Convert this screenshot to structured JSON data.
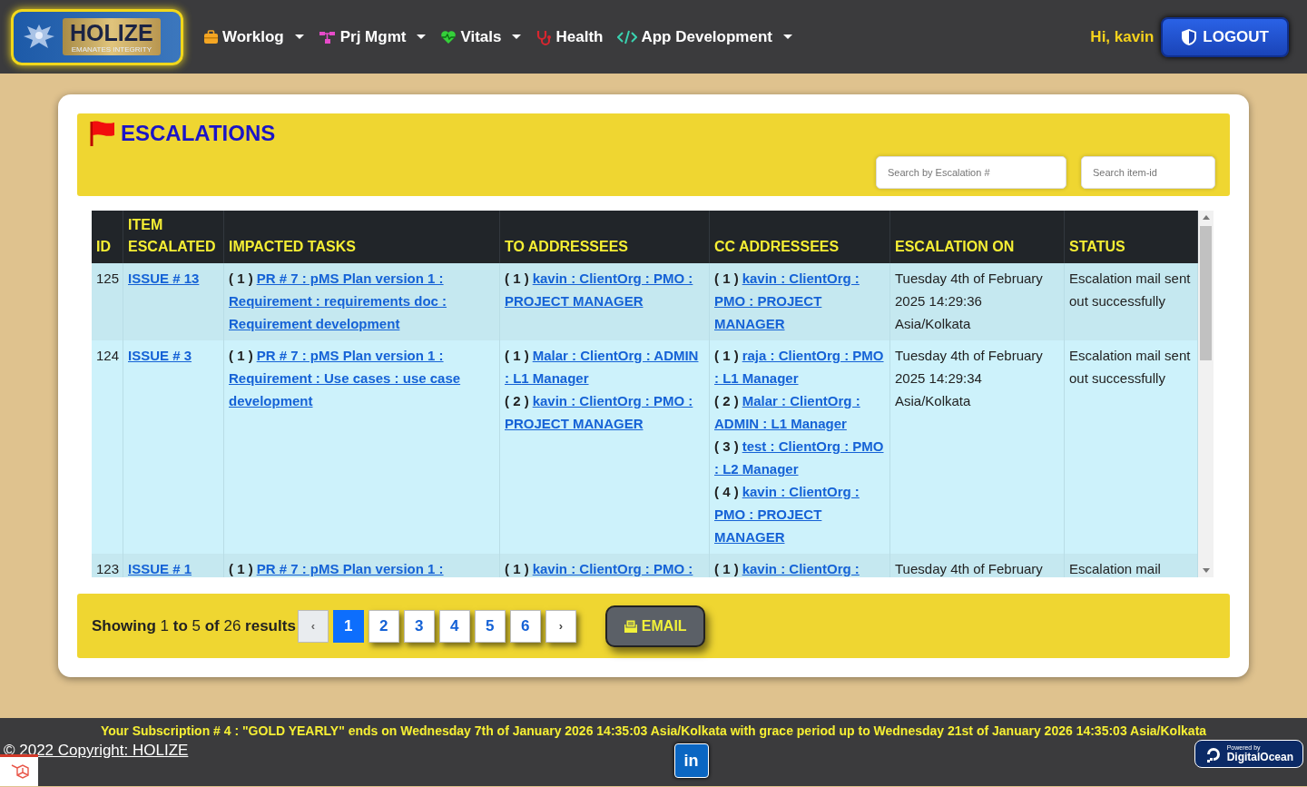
{
  "navbar": {
    "logo": {
      "title": "HOLIZE",
      "tagline": "EMANATES INTEGRITY"
    },
    "items": [
      {
        "label": "Worklog",
        "dropdown": true
      },
      {
        "label": "Prj Mgmt",
        "dropdown": true
      },
      {
        "label": "Vitals",
        "dropdown": true
      },
      {
        "label": "Health",
        "dropdown": false
      },
      {
        "label": "App Development",
        "dropdown": true
      }
    ],
    "greeting": "Hi, kavin",
    "logout": "LOGOUT"
  },
  "header": {
    "title": "ESCALATIONS",
    "search_escalation": {
      "placeholder": "Search by Escalation #"
    },
    "search_item": {
      "placeholder": "Search item-id"
    }
  },
  "table": {
    "columns": [
      [
        "ID"
      ],
      [
        "ITEM",
        "ESCALATED"
      ],
      [
        "IMPACTED TASKS"
      ],
      [
        "TO ADDRESSEES"
      ],
      [
        "CC ADDRESSEES"
      ],
      [
        "ESCALATION ON"
      ],
      [
        "STATUS"
      ]
    ],
    "rows": [
      {
        "id": "125",
        "item": "ISSUE # 13",
        "tasks": [
          {
            "index": "( 1 )",
            "text": "PR # 7 : pMS Plan version 1 : Requirement : requirements doc : Requirement development"
          }
        ],
        "to": [
          {
            "index": "( 1 )",
            "text": "kavin : ClientOrg : PMO : PROJECT MANAGER"
          }
        ],
        "cc": [
          {
            "index": "( 1 )",
            "text": "kavin : ClientOrg : PMO : PROJECT MANAGER"
          }
        ],
        "on": "Tuesday 4th of February 2025 14:29:36 Asia/Kolkata",
        "status": "Escalation mail sent out successfully"
      },
      {
        "id": "124",
        "item": "ISSUE # 3",
        "tasks": [
          {
            "index": "( 1 )",
            "text": "PR # 7 : pMS Plan version 1 : Requirement : Use cases : use case development"
          }
        ],
        "to": [
          {
            "index": "( 1 )",
            "text": "Malar : ClientOrg : ADMIN : L1 Manager"
          },
          {
            "index": "( 2 )",
            "text": "kavin : ClientOrg : PMO : PROJECT MANAGER"
          }
        ],
        "cc": [
          {
            "index": "( 1 )",
            "text": "raja : ClientOrg : PMO : L1 Manager"
          },
          {
            "index": "( 2 )",
            "text": "Malar : ClientOrg : ADMIN : L1 Manager"
          },
          {
            "index": "( 3 )",
            "text": "test : ClientOrg : PMO : L2 Manager"
          },
          {
            "index": "( 4 )",
            "text": "kavin : ClientOrg : PMO : PROJECT MANAGER"
          }
        ],
        "on": "Tuesday 4th of February 2025 14:29:34 Asia/Kolkata",
        "status": "Escalation mail sent out successfully"
      },
      {
        "id": "123",
        "item": "ISSUE # 1",
        "tasks": [
          {
            "index": "( 1 )",
            "text": "PR # 7 : pMS Plan version 1 :"
          }
        ],
        "to": [
          {
            "index": "( 1 )",
            "text": "kavin : ClientOrg : PMO :"
          }
        ],
        "cc": [
          {
            "index": "( 1 )",
            "text": "kavin : ClientOrg :"
          }
        ],
        "on": "Tuesday 4th of February",
        "status": "Escalation mail"
      }
    ]
  },
  "pagination": {
    "summary": "**Showing** 1 **to** 5 **of** 26 **results**",
    "prev": "‹",
    "next": "›",
    "pages": [
      {
        "label": "1",
        "selected": true
      },
      {
        "label": "2",
        "selected": false
      },
      {
        "label": "3",
        "selected": false
      },
      {
        "label": "4",
        "selected": false
      },
      {
        "label": "5",
        "selected": false
      },
      {
        "label": "6",
        "selected": false
      }
    ],
    "email": "EMAIL"
  },
  "footer": {
    "subscription": "Your Subscription # 4 : \"GOLD YEARLY\" ends on Wednesday 7th of January 2026 14:35:03 Asia/Kolkata with grace period up to Wednesday 21st of January 2026 14:35:03 Asia/Kolkata",
    "copyright": "© 2022 Copyright: HOLIZE",
    "linkedin": "in",
    "badge_small": "Powered by",
    "badge_name": "DigitalOcean"
  }
}
